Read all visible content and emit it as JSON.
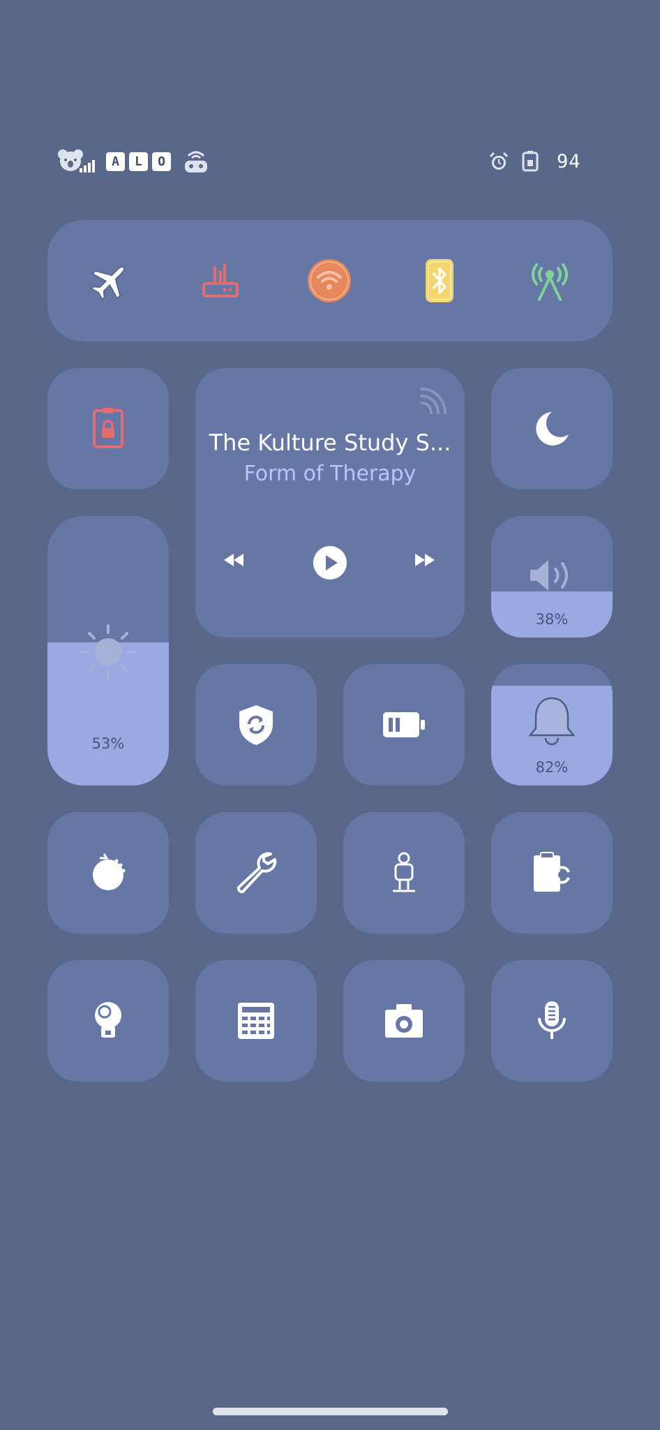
{
  "status_bar": {
    "left_icons": [
      "koala-signal-icon",
      "letter-a-icon",
      "letter-l-icon",
      "letter-o-icon",
      "robot-icon"
    ],
    "letters": [
      "A",
      "L",
      "O"
    ],
    "right_icons": [
      "alarm-icon",
      "battery-small-icon"
    ],
    "battery_level": "94"
  },
  "connectivity": {
    "toggles": [
      {
        "name": "airplane-mode",
        "icon": "airplane-icon",
        "color": "#FFFFFF",
        "active": false
      },
      {
        "name": "router",
        "icon": "router-icon",
        "color": "#E26D70",
        "active": true
      },
      {
        "name": "wifi",
        "icon": "wifi-icon",
        "color": "#E6875E",
        "active": true
      },
      {
        "name": "bluetooth",
        "icon": "bluetooth-icon",
        "color": "#F2D56C",
        "active": true
      },
      {
        "name": "cellular-data",
        "icon": "antenna-icon",
        "color": "#7CD49A",
        "active": true
      }
    ]
  },
  "media": {
    "track_title": "The Kulture Study S...",
    "artist": "Form of Therapy",
    "controls": [
      "rewind-icon",
      "play-icon",
      "fast-forward-icon",
      "airplay-icon"
    ]
  },
  "sliders": {
    "brightness": {
      "value": 0.53,
      "label": "53%",
      "icon": "sun-icon"
    },
    "volume": {
      "value": 0.38,
      "label": "38%",
      "icon": "speaker-icon"
    },
    "ringer": {
      "value": 0.82,
      "label": "82%",
      "icon": "bell-icon"
    }
  },
  "tiles": {
    "rotation_lock": {
      "icon": "lock-rotation-icon",
      "color": "#E26D70"
    },
    "do_not_disturb": {
      "icon": "moon-icon"
    },
    "vpn": {
      "icon": "shield-sync-icon"
    },
    "battery_saver": {
      "icon": "battery-icon"
    },
    "timer": {
      "icon": "timer-icon"
    },
    "tools": {
      "icon": "wrench-icon"
    },
    "accessibility": {
      "icon": "person-icon"
    },
    "clipboard_sync": {
      "icon": "clipboard-sync-icon"
    },
    "flashlight": {
      "icon": "lightbulb-icon"
    },
    "calculator": {
      "icon": "calculator-icon"
    },
    "camera": {
      "icon": "camera-icon"
    },
    "voice_memos": {
      "icon": "microphone-icon"
    }
  },
  "colors": {
    "background": "#59688A",
    "tile": "#6677A6",
    "slider_fill": "#9AA9E1",
    "accent_text": "#B4C6FF"
  }
}
